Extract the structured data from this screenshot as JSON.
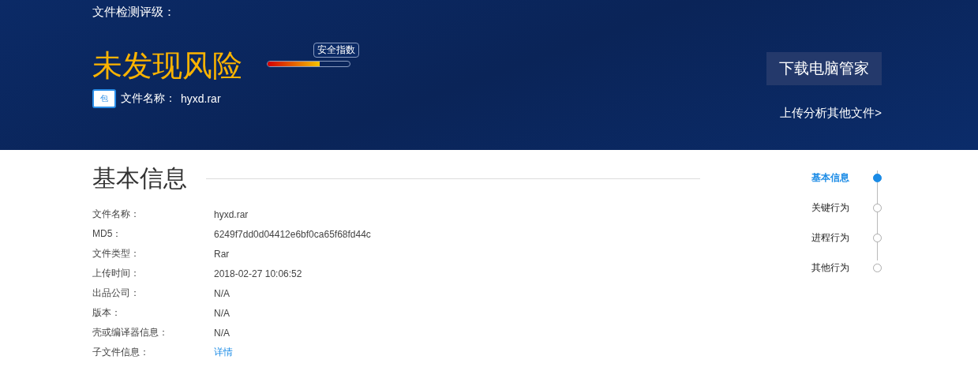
{
  "header": {
    "rating_label": "文件检测评级：",
    "verdict": "未发现风险",
    "meter": {
      "tooltip": "安全指数",
      "level": 0.63
    },
    "file_icon_label": "包",
    "file_label": "文件名称：",
    "file_name": "hyxd.rar",
    "download_button": "下载电脑管家",
    "upload_link": "上传分析其他文件>"
  },
  "section": {
    "title": "基本信息",
    "rows": [
      {
        "label": "文件名称：",
        "value": "hyxd.rar",
        "kind": "text"
      },
      {
        "label": "MD5：",
        "value": "6249f7dd0d04412e6bf0ca65f68fd44c",
        "kind": "text"
      },
      {
        "label": "文件类型：",
        "value": "Rar",
        "kind": "text"
      },
      {
        "label": "上传时间：",
        "value": "2018-02-27 10:06:52",
        "kind": "text"
      },
      {
        "label": "出品公司：",
        "value": "N/A",
        "kind": "text"
      },
      {
        "label": "版本：",
        "value": "N/A",
        "kind": "text"
      },
      {
        "label": "壳或编译器信息：",
        "value": "N/A",
        "kind": "text"
      },
      {
        "label": "子文件信息：",
        "value": "详情",
        "kind": "link"
      }
    ]
  },
  "nav": [
    {
      "label": "基本信息",
      "selected": true
    },
    {
      "label": "关键行为",
      "selected": false
    },
    {
      "label": "进程行为",
      "selected": false
    },
    {
      "label": "其他行为",
      "selected": false
    }
  ]
}
